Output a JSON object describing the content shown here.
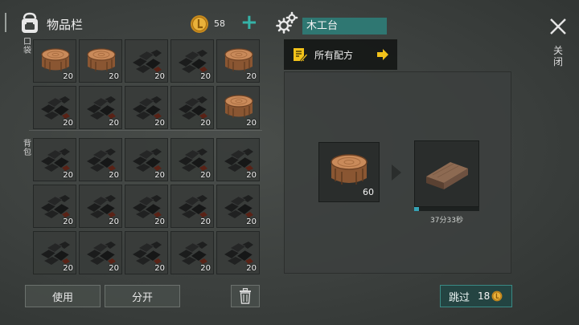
{
  "inventory": {
    "title": "物品栏",
    "coins": "58",
    "add_symbol": "+",
    "pocket_label": "口袋",
    "backpack_label": "背包",
    "pocket_slots": [
      {
        "item": "log",
        "count": "20"
      },
      {
        "item": "log",
        "count": "20"
      },
      {
        "item": "coal",
        "count": "20"
      },
      {
        "item": "coal",
        "count": "20"
      },
      {
        "item": "log",
        "count": "20"
      },
      {
        "item": "coal",
        "count": "20"
      },
      {
        "item": "coal",
        "count": "20"
      },
      {
        "item": "coal",
        "count": "20"
      },
      {
        "item": "coal",
        "count": "20"
      },
      {
        "item": "log",
        "count": "20"
      }
    ],
    "backpack_slots": [
      {
        "item": "coal",
        "count": "20"
      },
      {
        "item": "coal",
        "count": "20"
      },
      {
        "item": "coal",
        "count": "20"
      },
      {
        "item": "coal",
        "count": "20"
      },
      {
        "item": "coal",
        "count": "20"
      },
      {
        "item": "coal",
        "count": "20"
      },
      {
        "item": "coal",
        "count": "20"
      },
      {
        "item": "coal",
        "count": "20"
      },
      {
        "item": "coal",
        "count": "20"
      },
      {
        "item": "coal",
        "count": "20"
      },
      {
        "item": "coal",
        "count": "20"
      },
      {
        "item": "coal",
        "count": "20"
      },
      {
        "item": "coal",
        "count": "20"
      },
      {
        "item": "coal",
        "count": "20"
      },
      {
        "item": "coal",
        "count": "20"
      }
    ]
  },
  "actions": {
    "use_label": "使用",
    "split_label": "分开"
  },
  "crafting": {
    "station_name": "木工台",
    "recipes_label": "所有配方",
    "input_item": "log",
    "input_count": "60",
    "output_item": "plank",
    "progress": 0.07,
    "time_remaining": "37分33秒",
    "skip_label": "跳过",
    "skip_cost": "18"
  },
  "close_label": "关闭",
  "icons": {
    "bag": "backpack-icon",
    "coin": "coin-icon",
    "gears": "gears-icon",
    "recipes": "recipe-book-icon",
    "arrow": "arrow-right-icon",
    "trash": "trash-icon",
    "close": "close-icon"
  },
  "colors": {
    "accent_teal": "#35b3a8",
    "station_bg": "#2f7772",
    "arrow_yellow": "#f2c21a",
    "progress": "#35a3b6"
  }
}
